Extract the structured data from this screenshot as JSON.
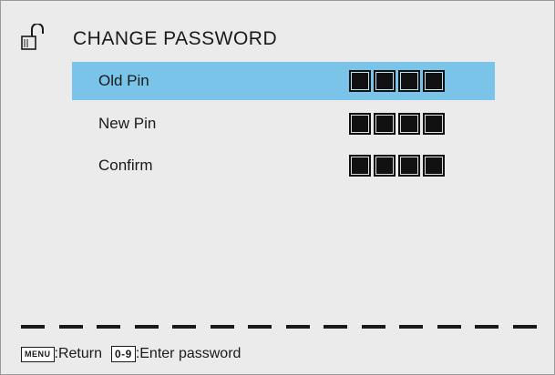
{
  "header": {
    "title": "CHANGE PASSWORD",
    "icon": "unlocked-padlock-icon"
  },
  "rows": [
    {
      "label": "Old Pin",
      "selected": true,
      "digits_entered": 0
    },
    {
      "label": "New Pin",
      "selected": false,
      "digits_entered": 0
    },
    {
      "label": "Confirm",
      "selected": false,
      "digits_entered": 0
    }
  ],
  "footer": {
    "menu_key": "MENU",
    "menu_action": ":Return",
    "digits_key": "0-9",
    "digits_action": ":Enter password"
  },
  "colors": {
    "background": "#ebebeb",
    "selection": "#7ac4ea",
    "text": "#1a1a1a"
  }
}
